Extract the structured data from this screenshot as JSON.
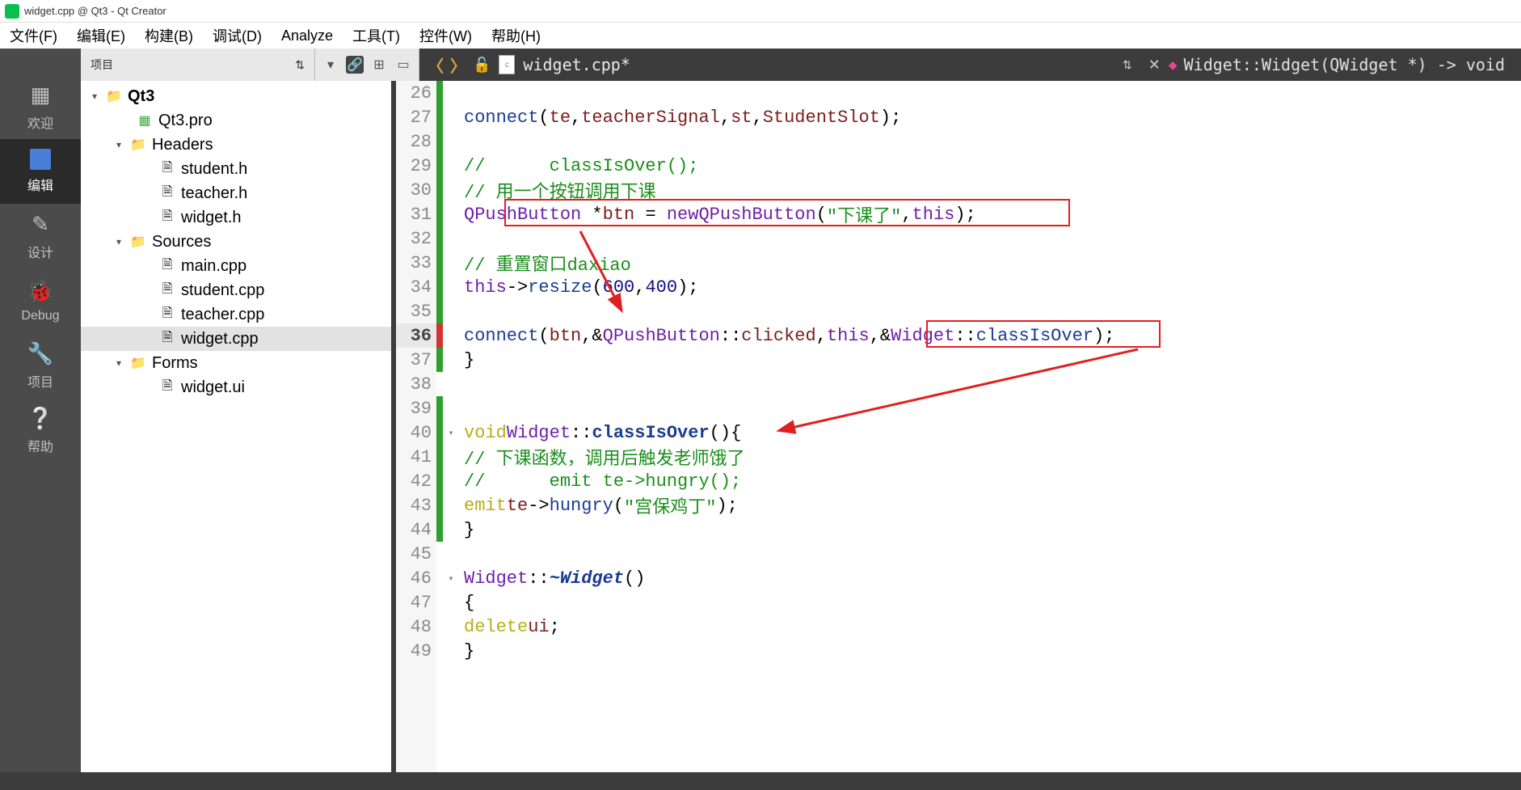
{
  "window": {
    "title": "widget.cpp @ Qt3 - Qt Creator"
  },
  "menubar": {
    "file": "文件(F)",
    "edit": "编辑(E)",
    "build": "构建(B)",
    "debug": "调试(D)",
    "analyze": "Analyze",
    "tools": "工具(T)",
    "widgets": "控件(W)",
    "help": "帮助(H)"
  },
  "nav": {
    "welcome": "欢迎",
    "edit": "编辑",
    "design": "设计",
    "debug": "Debug",
    "project": "项目",
    "help": "帮助"
  },
  "toolbar": {
    "project_dropdown": "项目",
    "current_file": "widget.cpp*",
    "breadcrumb": "Widget::Widget(QWidget *) -> void"
  },
  "tree": {
    "root": "Qt3",
    "proj_file": "Qt3.pro",
    "headers_label": "Headers",
    "headers": [
      "student.h",
      "teacher.h",
      "widget.h"
    ],
    "sources_label": "Sources",
    "sources": [
      "main.cpp",
      "student.cpp",
      "teacher.cpp",
      "widget.cpp"
    ],
    "forms_label": "Forms",
    "forms": [
      "widget.ui"
    ]
  },
  "code": {
    "l26": "",
    "l27": "        connect(te,teacherSignal,st,StudentSlot);",
    "l28": "",
    "l29": "//      classIsOver();",
    "l30": "        // 用一个按钮调用下课",
    "l31": "        QPushButton *btn = new QPushButton(\"下课了\",this);",
    "l32": "",
    "l33": "        // 重置窗口daxiao",
    "l34": "        this->resize(600,400);",
    "l35": "",
    "l36": "        connect(btn,&QPushButton::clicked,this,&Widget::classIsOver);",
    "l37": "    }",
    "l38": "",
    "l39": "",
    "l40": "void Widget::classIsOver(){",
    "l41": "        // 下课函数，调用后触发老师饿了",
    "l42": "//      emit te->hungry();",
    "l43": "        emit te->hungry(\"宫保鸡丁\");",
    "l44": "    }",
    "l45": "",
    "l46": "Widget::~Widget()",
    "l47": "    {",
    "l48": "        delete ui;",
    "l49": "    }"
  },
  "linenums": [
    26,
    27,
    28,
    29,
    30,
    31,
    32,
    33,
    34,
    35,
    36,
    37,
    38,
    39,
    40,
    41,
    42,
    43,
    44,
    45,
    46,
    47,
    48,
    49
  ],
  "current_line": 36
}
